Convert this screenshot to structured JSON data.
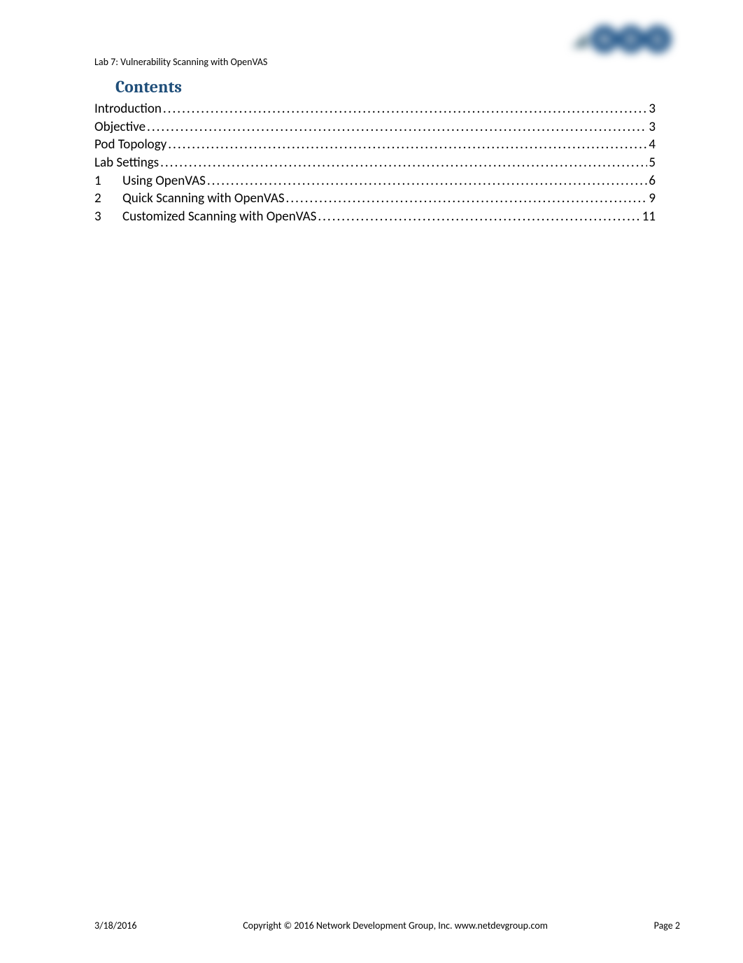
{
  "header": {
    "lab_label": "Lab 7:  Vulnerability Scanning with OpenVAS"
  },
  "contents_heading": "Contents",
  "toc": [
    {
      "num": "",
      "title": "Introduction",
      "page": "3"
    },
    {
      "num": "",
      "title": "Objective",
      "page": "3"
    },
    {
      "num": "",
      "title": "Pod Topology",
      "page": "4"
    },
    {
      "num": "",
      "title": "Lab Settings",
      "page": "5"
    },
    {
      "num": "1",
      "title": "Using OpenVAS",
      "page": "6"
    },
    {
      "num": "2",
      "title": "Quick Scanning with OpenVAS",
      "page": "9"
    },
    {
      "num": "3",
      "title": "Customized Scanning with OpenVAS",
      "page": "11"
    }
  ],
  "footer": {
    "date": "3/18/2016",
    "copyright": "Copyright © 2016 Network Development Group, Inc.   www.netdevgroup.com",
    "page_label": "Page 2"
  }
}
